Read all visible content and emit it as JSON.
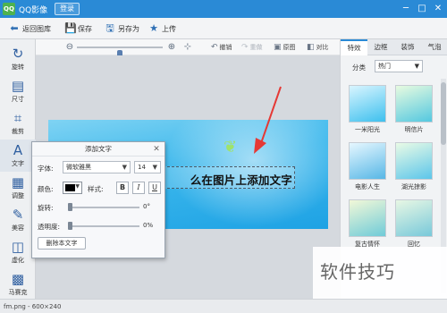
{
  "window": {
    "logo_text": "QQ",
    "title": "QQ影像",
    "login_label": "登录",
    "min_glyph": "─",
    "max_glyph": "□",
    "close_glyph": "✕"
  },
  "toolbar": {
    "back_label": "返回图库",
    "save_label": "保存",
    "save_as_label": "另存为",
    "upload_label": "上传"
  },
  "leftbar": {
    "items": [
      {
        "label": "旋转",
        "glyph": "↻"
      },
      {
        "label": "尺寸",
        "glyph": "▤"
      },
      {
        "label": "裁剪",
        "glyph": "⌗"
      },
      {
        "label": "文字",
        "glyph": "A"
      },
      {
        "label": "调整",
        "glyph": "▦"
      },
      {
        "label": "美容",
        "glyph": "✎"
      },
      {
        "label": "虚化",
        "glyph": "◫"
      },
      {
        "label": "马赛克",
        "glyph": "▩"
      }
    ],
    "active_index": 3
  },
  "viewbar": {
    "zoom_out_glyph": "⊖",
    "zoom_in_glyph": "⊕",
    "fit_glyph": "⊹",
    "zoom_level": 0.5,
    "undo_label": "撤销",
    "redo_label": "重做",
    "original_label": "原图",
    "compare_label": "对比"
  },
  "canvas": {
    "overlay_text": "么在图片上添加文字"
  },
  "dialog": {
    "title": "添加文字",
    "font_label": "字体:",
    "font_value": "微软雅黑",
    "size_value": "14",
    "color_label": "颜色:",
    "style_label": "样式:",
    "bold_label": "B",
    "italic_label": "I",
    "underline_label": "U",
    "rotation_label": "旋转:",
    "rotation_value": "0°",
    "opacity_label": "透明度:",
    "opacity_value": "0%",
    "delete_label": "删除本文字",
    "text_color": "#000000"
  },
  "rightpanel": {
    "tabs": [
      "特效",
      "边框",
      "装饰",
      "气泡"
    ],
    "active_tab": 0,
    "category_label": "分类",
    "category_value": "热门",
    "thumbnails": [
      {
        "label": "一米阳光",
        "color1": "#d9f5ff",
        "color2": "#3ec0ee"
      },
      {
        "label": "明信片",
        "color1": "#e8fbe0",
        "color2": "#54c8e0"
      },
      {
        "label": "电影人生",
        "color1": "#e6f7ff",
        "color2": "#57b7e6"
      },
      {
        "label": "湖光掠影",
        "color1": "#eafbe6",
        "color2": "#5cc6ea"
      },
      {
        "label": "复古情怀",
        "color1": "#f2f8d8",
        "color2": "#6fcbd8"
      },
      {
        "label": "回忆",
        "color1": "#e8f7e4",
        "color2": "#78c9da"
      }
    ]
  },
  "status": {
    "file_info": "fm.png - 600×240"
  },
  "watermark": {
    "text": "软件技巧"
  },
  "colors": {
    "accent": "#2a8ad6",
    "arrow": "#e53935"
  }
}
